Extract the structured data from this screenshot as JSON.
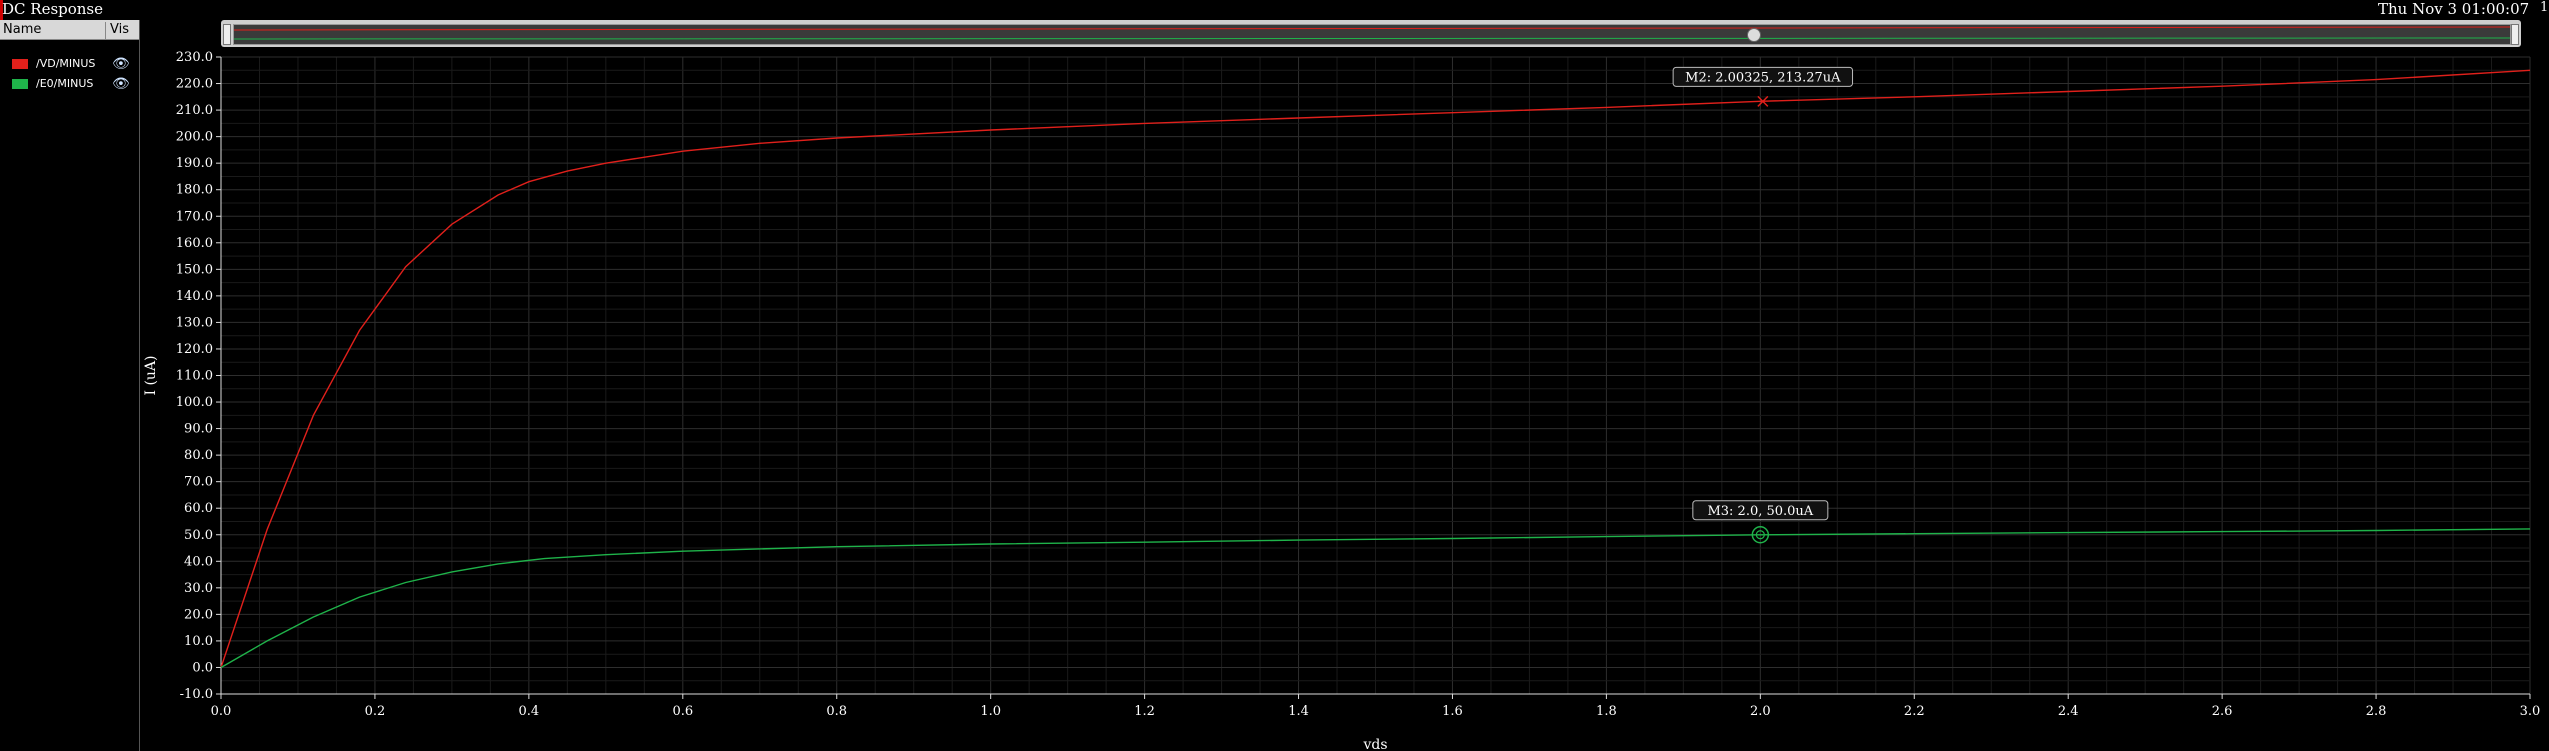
{
  "window": {
    "title": "DC Response",
    "datetime": "Thu Nov 3 01:00:07",
    "corner_mark": "1"
  },
  "legend": {
    "col_name": "Name",
    "col_vis": "Vis",
    "items": [
      {
        "name": "/VD/MINUS",
        "color": "#e0201b",
        "visible_icon": "eye-icon"
      },
      {
        "name": "/E0/MINUS",
        "color": "#1fb34a",
        "visible_icon": "eye-icon"
      }
    ]
  },
  "chart_data": {
    "type": "line",
    "xlabel": "vds",
    "ylabel": "I (uA)",
    "xlim": [
      0.0,
      3.0
    ],
    "ylim": [
      -10.0,
      230.0
    ],
    "xticks": [
      "0.0",
      "0.2",
      "0.4",
      "0.6",
      "0.8",
      "1.0",
      "1.2",
      "1.4",
      "1.6",
      "1.8",
      "2.0",
      "2.2",
      "2.4",
      "2.6",
      "2.8",
      "3.0"
    ],
    "yticks": [
      "230.0",
      "220.0",
      "210.0",
      "200.0",
      "190.0",
      "180.0",
      "170.0",
      "160.0",
      "150.0",
      "140.0",
      "130.0",
      "120.0",
      "110.0",
      "100.0",
      "90.0",
      "80.0",
      "70.0",
      "60.0",
      "50.0",
      "40.0",
      "30.0",
      "20.0",
      "10.0",
      "0.0",
      "-10.0"
    ],
    "grid": true,
    "series": [
      {
        "name": "/VD/MINUS",
        "color": "#e0201b",
        "x": [
          0,
          0.06,
          0.12,
          0.18,
          0.24,
          0.3,
          0.36,
          0.4,
          0.45,
          0.5,
          0.6,
          0.7,
          0.8,
          1.0,
          1.2,
          1.4,
          1.6,
          1.8,
          2.0,
          2.2,
          2.4,
          2.6,
          2.8,
          3.0
        ],
        "y": [
          0,
          52,
          95,
          127,
          151,
          167,
          178,
          183,
          187,
          190,
          194.5,
          197.5,
          199.5,
          202.5,
          205,
          207,
          209,
          211,
          213.3,
          215,
          217,
          219,
          221.5,
          225
        ]
      },
      {
        "name": "/E0/MINUS",
        "color": "#1fb34a",
        "x": [
          0,
          0.06,
          0.12,
          0.18,
          0.24,
          0.3,
          0.36,
          0.42,
          0.5,
          0.6,
          0.8,
          1.0,
          1.2,
          1.4,
          1.6,
          1.8,
          2.0,
          2.2,
          2.4,
          2.6,
          2.8,
          3.0
        ],
        "y": [
          0,
          10,
          19,
          26.5,
          32,
          36,
          39,
          41,
          42.5,
          43.8,
          45.5,
          46.5,
          47.2,
          48,
          48.6,
          49.3,
          50,
          50.4,
          50.8,
          51.2,
          51.6,
          52.2
        ]
      }
    ],
    "markers": [
      {
        "label": "M2: 2.00325, 213.27uA",
        "x": 2.00325,
        "y": 213.27,
        "series": "/VD/MINUS",
        "shape": "x"
      },
      {
        "label": "M3: 2.0, 50.0uA",
        "x": 2.0,
        "y": 50.0,
        "series": "/E0/MINUS",
        "shape": "circle"
      }
    ]
  }
}
